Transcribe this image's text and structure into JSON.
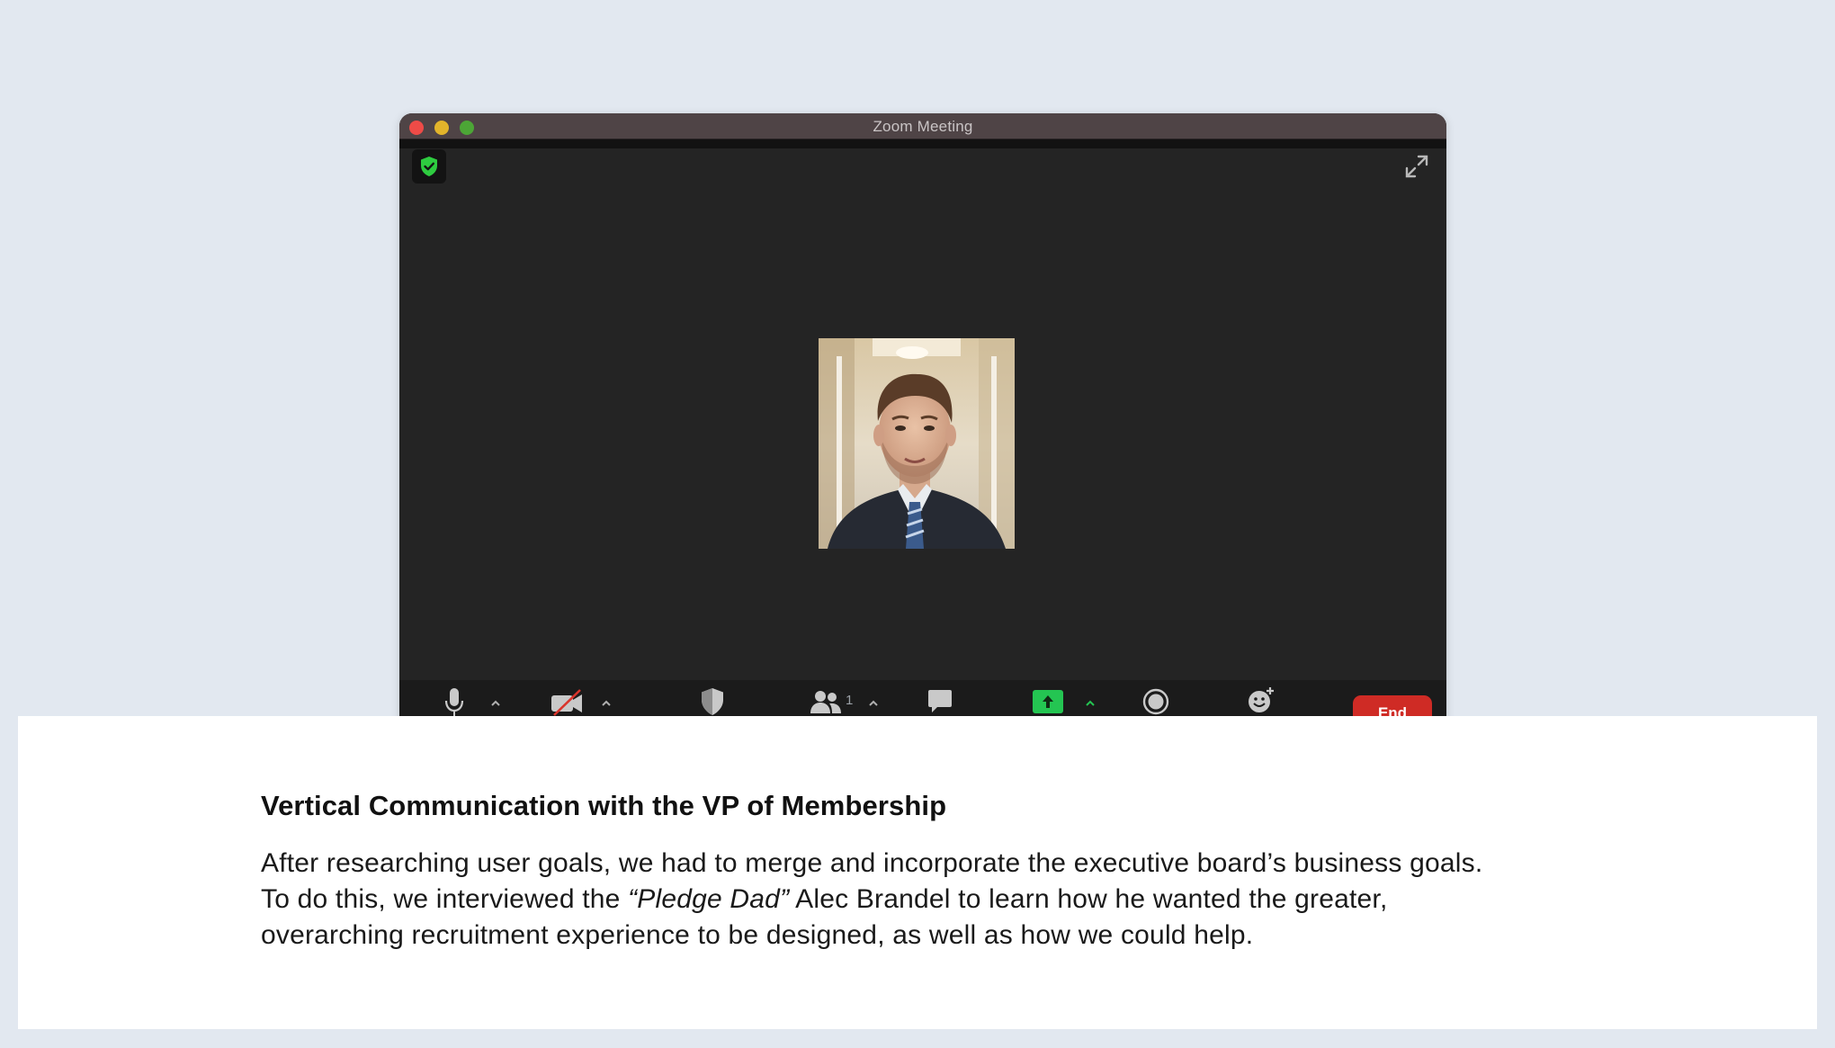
{
  "window": {
    "title": "Zoom Meeting",
    "traffic_lights": [
      "close",
      "minimize",
      "maximize"
    ]
  },
  "meeting": {
    "security_icon": "shield-check-icon",
    "fullscreen_icon": "expand-arrows-icon",
    "participant_photo": "man in suit and striped tie, hallway background"
  },
  "toolbar": {
    "items": [
      {
        "name": "microphone-icon"
      },
      {
        "name": "video-off-icon"
      },
      {
        "name": "security-shield-icon"
      },
      {
        "name": "participants-icon",
        "count": "1"
      },
      {
        "name": "chat-icon"
      },
      {
        "name": "share-screen-icon"
      },
      {
        "name": "record-icon"
      },
      {
        "name": "reactions-icon"
      }
    ],
    "end_label": "End"
  },
  "card": {
    "title": "Vertical Communication with the VP of Membership",
    "body_line1": "After researching user goals, we had to merge and incorporate the executive board’s business goals.",
    "body_line2_pre": "To do this, we interviewed the ",
    "body_line2_em": "“Pledge Dad”",
    "body_line2_post": " Alec Brandel to learn how he wanted the greater,",
    "body_line3": "overarching recruitment experience to be designed, as well as how we could help."
  },
  "colors": {
    "page_bg": "#e2e8f0",
    "window_bg": "#242424",
    "titlebar": "#4f4446",
    "share_green": "#24c552",
    "end_red": "#cf2b25",
    "security_green": "#2ecc40"
  }
}
